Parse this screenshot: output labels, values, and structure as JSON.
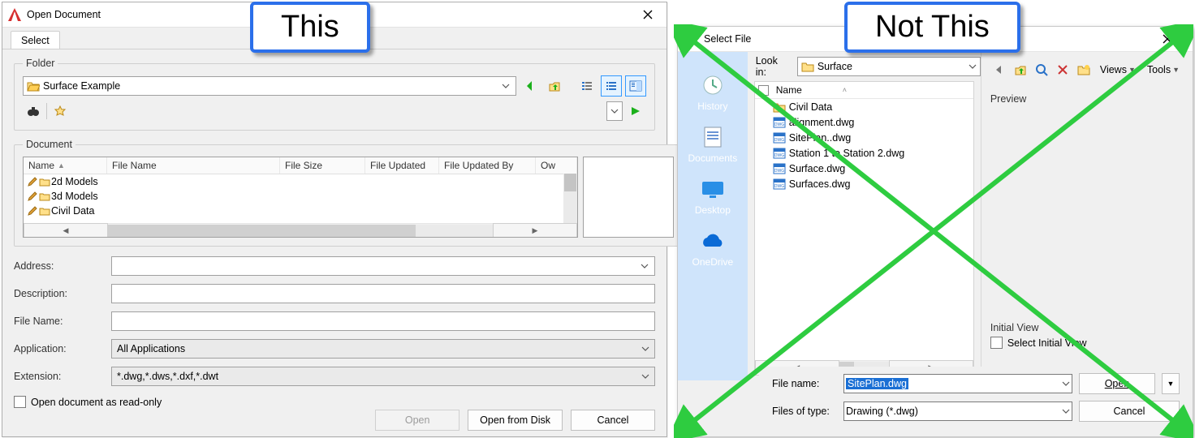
{
  "callouts": {
    "this": "This",
    "not_this": "Not This"
  },
  "left": {
    "title": "Open Document",
    "tab": "Select",
    "folder": {
      "legend": "Folder",
      "selected": "Surface Example"
    },
    "document": {
      "legend": "Document",
      "columns": {
        "name": "Name",
        "file_name": "File Name",
        "file_size": "File Size",
        "file_updated": "File Updated",
        "file_updated_by": "File Updated By",
        "owner": "Ow"
      },
      "rows": [
        {
          "label": "2d Models"
        },
        {
          "label": "3d Models"
        },
        {
          "label": "Civil Data"
        }
      ]
    },
    "form": {
      "address": "Address:",
      "description": "Description:",
      "file_name": "File Name:",
      "application": "Application:",
      "application_value": "All Applications",
      "extension": "Extension:",
      "extension_value": "*.dwg,*.dws,*.dxf,*.dwt",
      "readonly": "Open document as read-only"
    },
    "buttons": {
      "open": "Open",
      "open_from_disk": "Open from Disk",
      "cancel": "Cancel"
    }
  },
  "right": {
    "title": "Select File",
    "lookin_label": "Look in:",
    "lookin_value": "Surface",
    "menus": {
      "views": "Views",
      "tools": "Tools"
    },
    "places": {
      "history": "History",
      "documents": "Documents",
      "desktop": "Desktop",
      "onedrive": "OneDrive"
    },
    "filelist": {
      "name_header": "Name",
      "rows": [
        {
          "type": "folder",
          "label": "Civil Data"
        },
        {
          "type": "dwg",
          "label": "alignment.dwg"
        },
        {
          "type": "dwg",
          "label": "SitePlan..dwg"
        },
        {
          "type": "dwg",
          "label": "Station 1 to Station 2.dwg"
        },
        {
          "type": "dwg",
          "label": "Surface.dwg"
        },
        {
          "type": "dwg",
          "label": "Surfaces.dwg"
        }
      ]
    },
    "preview_label": "Preview",
    "initial_view_label": "Initial View",
    "select_initial_view": "Select Initial View",
    "footer": {
      "file_name_label": "File name:",
      "file_name_value": "SitePlan.dwg",
      "files_of_type_label": "Files of type:",
      "files_of_type_value": "Drawing (*.dwg)",
      "open": "Open",
      "cancel": "Cancel"
    }
  }
}
